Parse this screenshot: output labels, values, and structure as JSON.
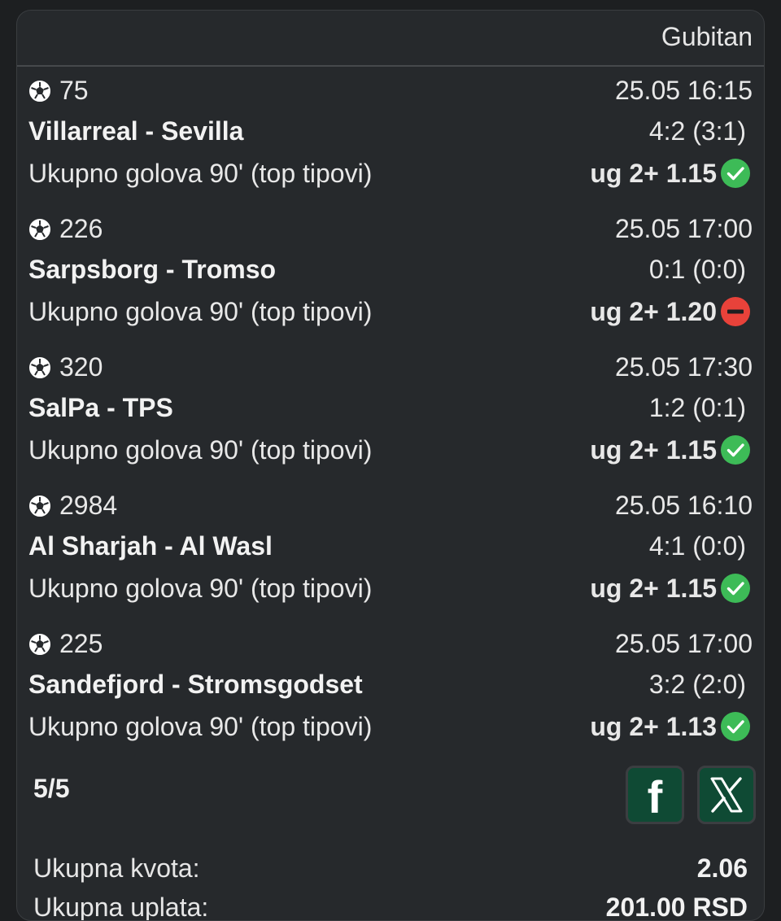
{
  "ticket": {
    "status": "Gubitan",
    "matches": [
      {
        "code": "75",
        "datetime": "25.05 16:15",
        "teams": "Villarreal - Sevilla",
        "score": "4:2 (3:1)",
        "market": "Ukupno golova 90' (top tipovi)",
        "pick": "ug 2+ 1.15",
        "result": "won"
      },
      {
        "code": "226",
        "datetime": "25.05 17:00",
        "teams": "Sarpsborg - Tromso",
        "score": "0:1 (0:0)",
        "market": "Ukupno golova 90' (top tipovi)",
        "pick": "ug 2+ 1.20",
        "result": "lost"
      },
      {
        "code": "320",
        "datetime": "25.05 17:30",
        "teams": "SalPa - TPS",
        "score": "1:2 (0:1)",
        "market": "Ukupno golova 90' (top tipovi)",
        "pick": "ug 2+ 1.15",
        "result": "won"
      },
      {
        "code": "2984",
        "datetime": "25.05 16:10",
        "teams": "Al Sharjah - Al Wasl",
        "score": "4:1 (0:0)",
        "market": "Ukupno golova 90' (top tipovi)",
        "pick": "ug 2+ 1.15",
        "result": "won"
      },
      {
        "code": "225",
        "datetime": "25.05 17:00",
        "teams": "Sandefjord - Stromsgodset",
        "score": "3:2 (2:0)",
        "market": "Ukupno golova 90' (top tipovi)",
        "pick": "ug 2+ 1.13",
        "result": "won"
      }
    ],
    "count": "5/5",
    "total_odds_label": "Ukupna kvota:",
    "total_odds_value": "2.06",
    "cut_label": "Ukupna uplata:",
    "cut_value": "201.00 RSD"
  },
  "share": {
    "facebook_icon": "facebook-icon",
    "x_icon": "x-icon",
    "facebook_glyph": "f"
  },
  "colors": {
    "background": "#1d1f21",
    "card": "#26292c",
    "won": "#3dbb57",
    "lost": "#e8423a",
    "share_button": "#0f4a34"
  }
}
